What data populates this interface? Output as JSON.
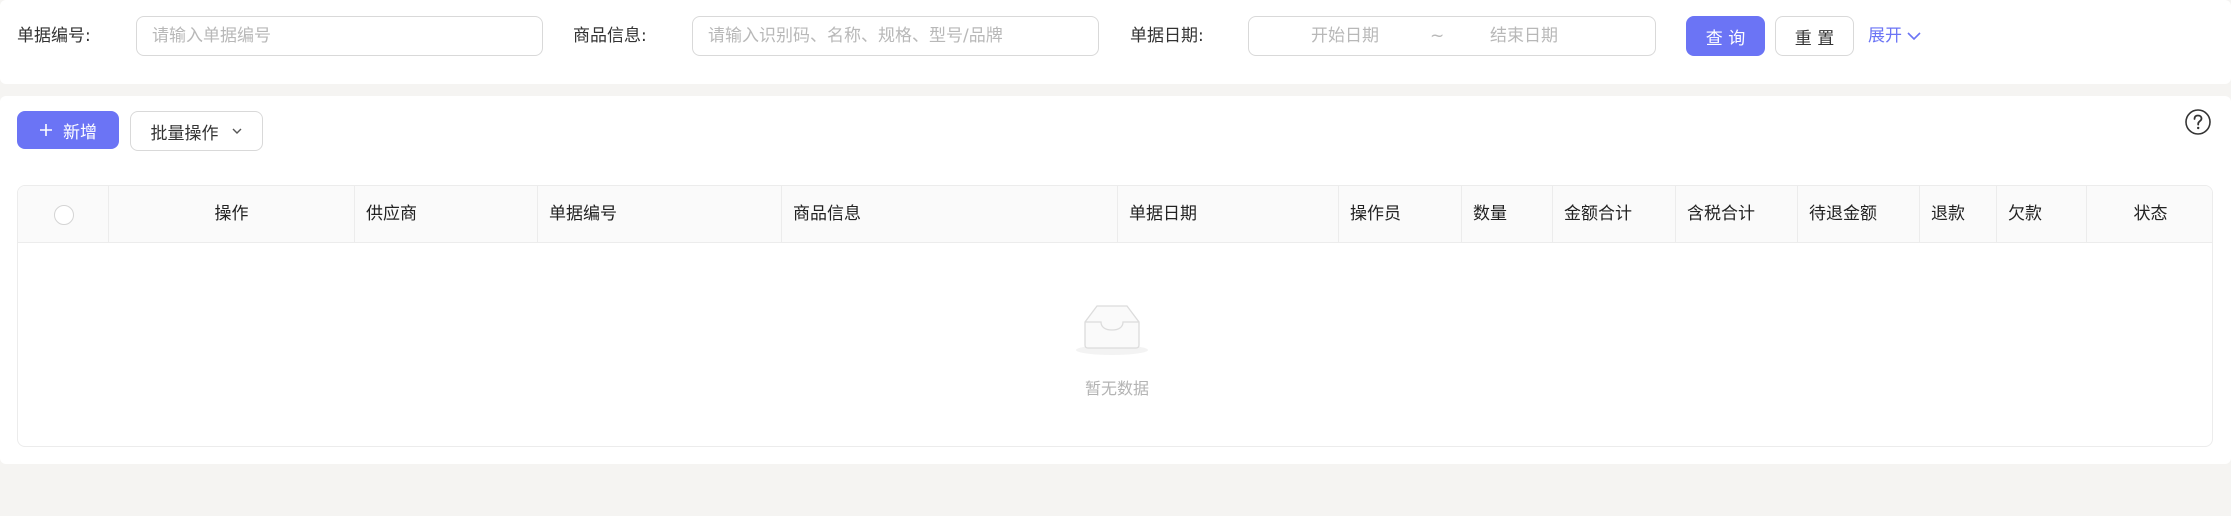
{
  "search": {
    "doc_no_label": "单据编号:",
    "doc_no_placeholder": "请输入单据编号",
    "product_label": "商品信息:",
    "product_placeholder": "请输入识别码、名称、规格、型号/品牌",
    "date_label": "单据日期:",
    "start_placeholder": "开始日期",
    "separator": "~",
    "end_placeholder": "结束日期",
    "query_button": "查 询",
    "reset_button": "重 置",
    "expand_link": "展开"
  },
  "toolbar": {
    "add_button": "新增",
    "batch_button": "批量操作"
  },
  "table": {
    "columns": [
      "操作",
      "供应商",
      "单据编号",
      "商品信息",
      "单据日期",
      "操作员",
      "数量",
      "金额合计",
      "含税合计",
      "待退金额",
      "退款",
      "欠款",
      "状态"
    ],
    "empty_text": "暂无数据"
  },
  "colors": {
    "primary": "#6b74f5",
    "background": "#f5f4f2",
    "border": "#d9d9d9"
  },
  "icons": {
    "add": "plus-icon",
    "batch": "chevron-down-icon",
    "expand": "chevron-down-icon",
    "help": "question-circle-icon",
    "empty": "inbox-icon"
  }
}
